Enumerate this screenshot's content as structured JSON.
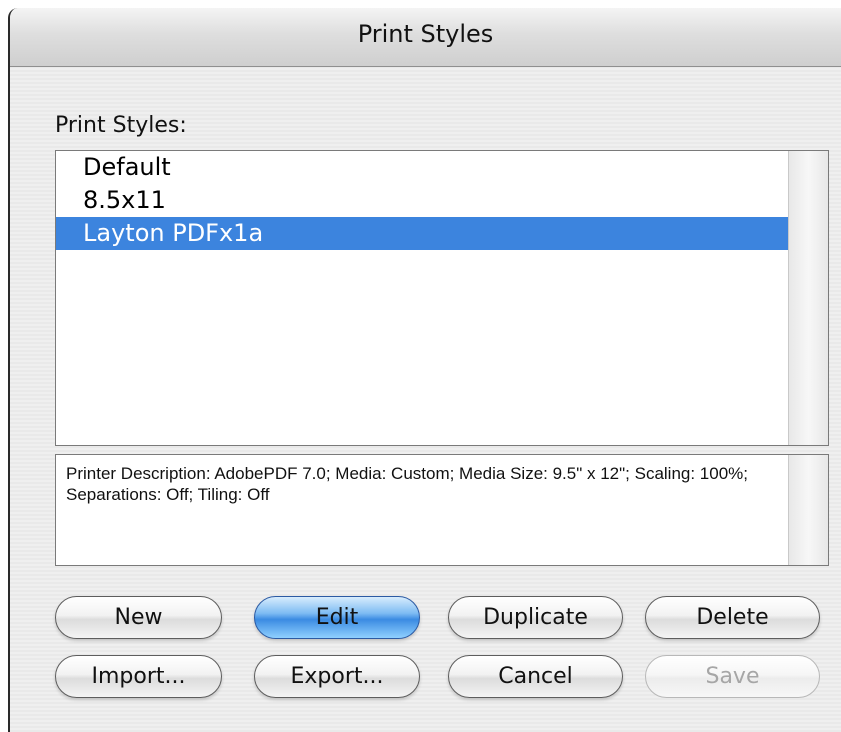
{
  "window": {
    "title": "Print Styles"
  },
  "styles_panel": {
    "label": "Print Styles:",
    "items": [
      {
        "label": "Default",
        "selected": false
      },
      {
        "label": "8.5x11",
        "selected": false
      },
      {
        "label": "Layton PDFx1a",
        "selected": true
      }
    ],
    "description": "Printer Description: AdobePDF 7.0;   Media: Custom;   Media Size: 9.5\" x 12\";   Scaling: 100%;   Separations: Off;   Tiling: Off"
  },
  "buttons": {
    "new": "New",
    "edit": "Edit",
    "duplicate": "Duplicate",
    "delete": "Delete",
    "import": "Import...",
    "export": "Export...",
    "cancel": "Cancel",
    "save": "Save"
  },
  "colors": {
    "selection": "#3c84de",
    "default_button": "#3b8be2"
  }
}
